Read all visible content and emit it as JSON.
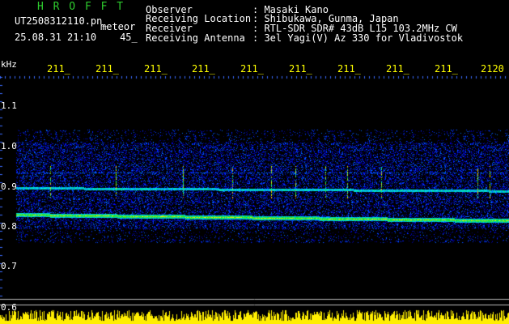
{
  "header": {
    "brand": "H R O F F T",
    "filename": "UT2508312110.pn_",
    "tag": "meteor",
    "timestamp": "25.08.31 21:10",
    "count": "45_"
  },
  "info": [
    {
      "label": "Observer",
      "value": ": Masaki Kano"
    },
    {
      "label": "Receiving Location",
      "value": ": Shibukawa, Gunma, Japan"
    },
    {
      "label": "Receiver",
      "value": ": RTL-SDR SDR# 43dB L15 103.2MHz CW"
    },
    {
      "label": "Receiving Antenna",
      "value": ": 3el Yagi(V) Az 330 for Vladivostok"
    }
  ],
  "axis": {
    "y_unit": "kHz",
    "time_ticks": [
      "211_",
      "211_",
      "211_",
      "211_",
      "211_",
      "211_",
      "211_",
      "211_",
      "211_",
      "2120"
    ],
    "freq_ticks": [
      "1.1",
      "1.0",
      "0.9",
      "0.8",
      "0.7",
      "0.6"
    ]
  },
  "colors": {
    "background": "#000000",
    "brand": "#2ecc2e",
    "time_ticks": "#ffff00",
    "tick_marks": "#3a6bff",
    "level_bar": "#ffee00"
  }
}
